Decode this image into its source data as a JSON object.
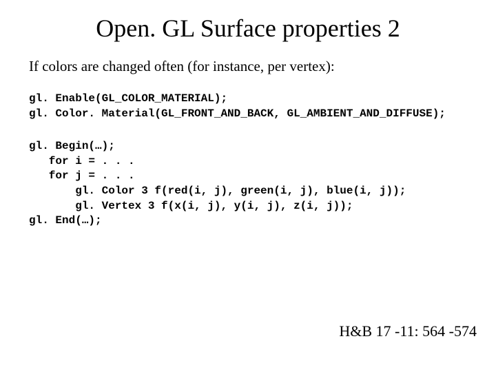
{
  "title": "Open. GL Surface properties 2",
  "intro": "If colors are changed often (for instance, per vertex):",
  "code1": "gl. Enable(GL_COLOR_MATERIAL);\ngl. Color. Material(GL_FRONT_AND_BACK, GL_AMBIENT_AND_DIFFUSE);",
  "code2": "gl. Begin(…);\n   for i = . . .\n   for j = . . .\n       gl. Color 3 f(red(i, j), green(i, j), blue(i, j));\n       gl. Vertex 3 f(x(i, j), y(i, j), z(i, j));\ngl. End(…);",
  "reference": "H&B 17 -11: 564 -574"
}
